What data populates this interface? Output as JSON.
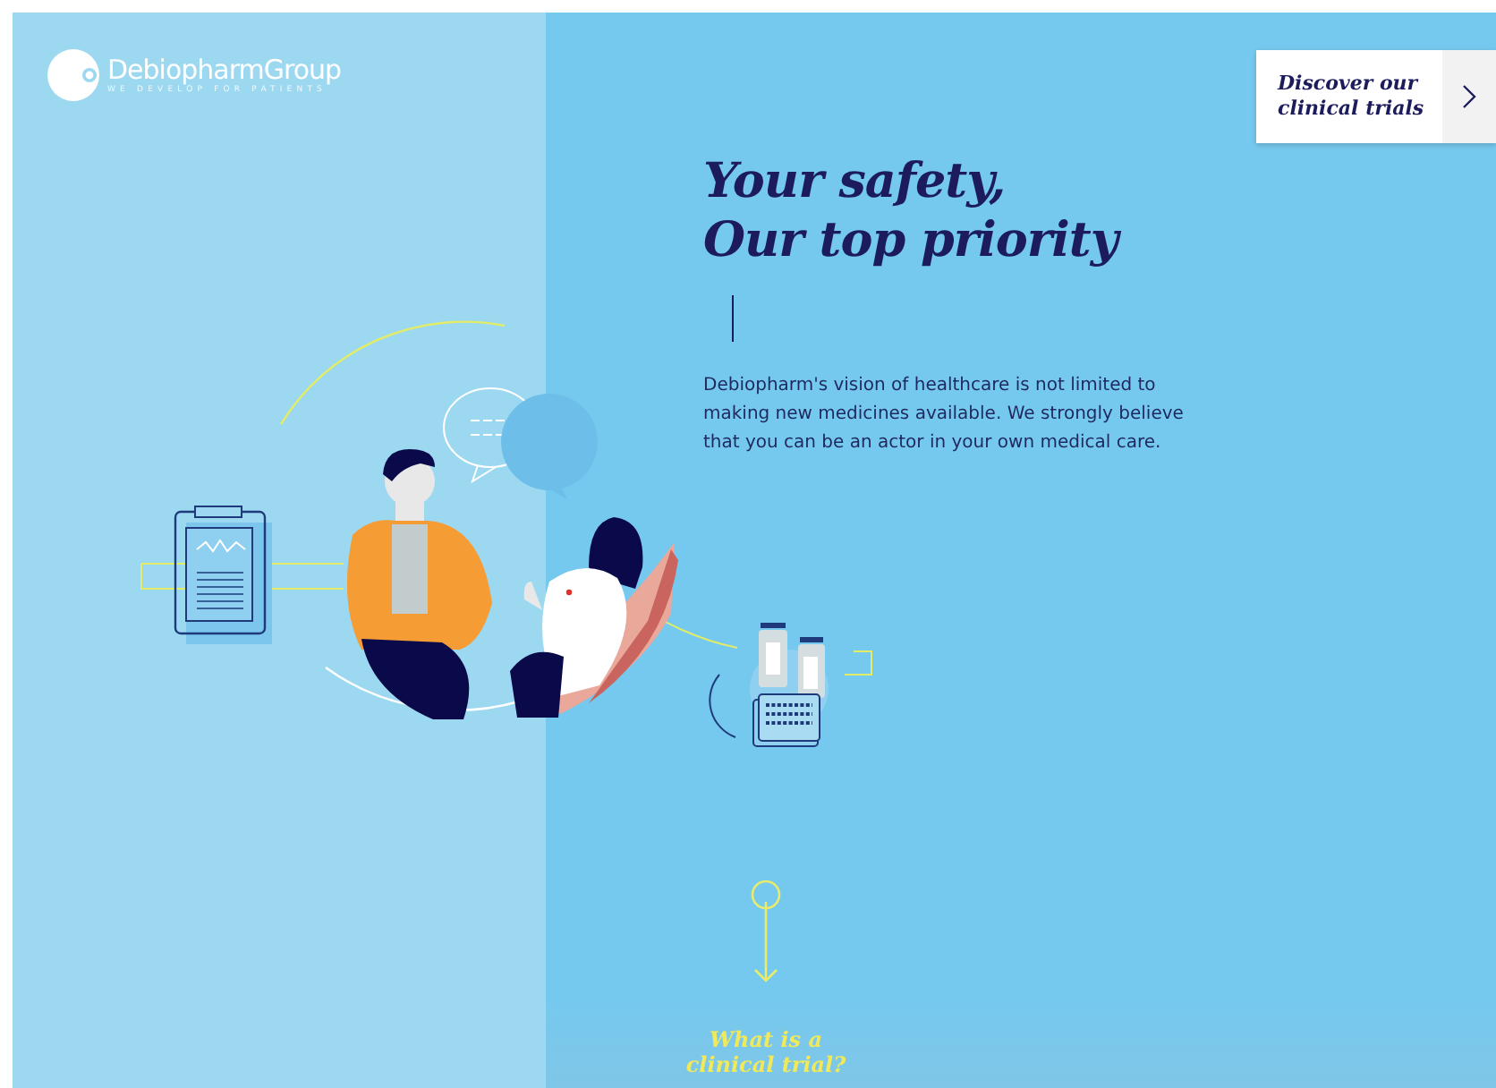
{
  "logo": {
    "name": "DebiopharmGroup",
    "tagline": "WE DEVELOP FOR PATIENTS"
  },
  "cta": {
    "label": "Discover our clinical trials"
  },
  "hero": {
    "title_lines": [
      "Your safety,",
      "Our top priority"
    ],
    "body": "Debiopharm's vision of healthcare is not limited to making new medicines available. We strongly believe that you can be an actor in your own medical care."
  },
  "scroll_prompt": {
    "label": "What is a clinical trial?"
  }
}
